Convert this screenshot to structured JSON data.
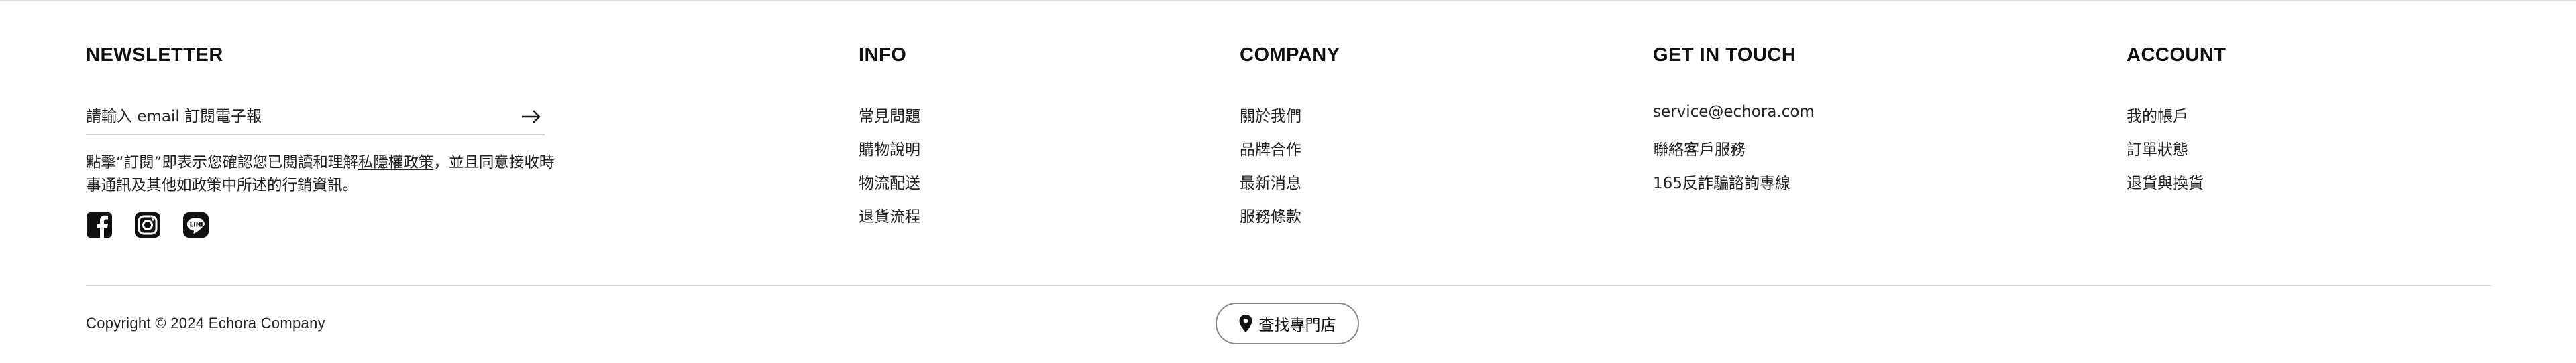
{
  "newsletter": {
    "title": "NEWSLETTER",
    "input_placeholder": "請輸入 email 訂閱電子報",
    "submit_icon": "arrow-right-icon",
    "consent_prefix": "點擊“訂閱”即表示您確認您已閱讀和理解",
    "consent_link": "私隱權政策",
    "consent_suffix": "，並且同意接收時事通訊及其他如政策中所述的行銷資訊。",
    "social_icons": [
      "facebook-icon",
      "instagram-icon",
      "line-icon"
    ]
  },
  "info": {
    "title": "INFO",
    "items": [
      "常見問題",
      "購物說明",
      "物流配送",
      "退貨流程"
    ]
  },
  "company": {
    "title": "COMPANY",
    "items": [
      "關於我們",
      "品牌合作",
      "最新消息",
      "服務條款"
    ]
  },
  "contact": {
    "title": "GET IN TOUCH",
    "items": [
      "service@echora.com",
      "聯絡客戶服務",
      "165反詐騙諮詢專線"
    ]
  },
  "account": {
    "title": "ACCOUNT",
    "items": [
      "我的帳戶",
      "訂單狀態",
      "退貨與換貨"
    ]
  },
  "footer": {
    "copyright": "Copyright © 2024 Echora Company",
    "store_locator_label": "查找專門店",
    "store_locator_icon": "map-pin-icon"
  },
  "colors": {
    "text": "#111111",
    "rule": "#dcdcdc",
    "button_border": "#888888"
  }
}
